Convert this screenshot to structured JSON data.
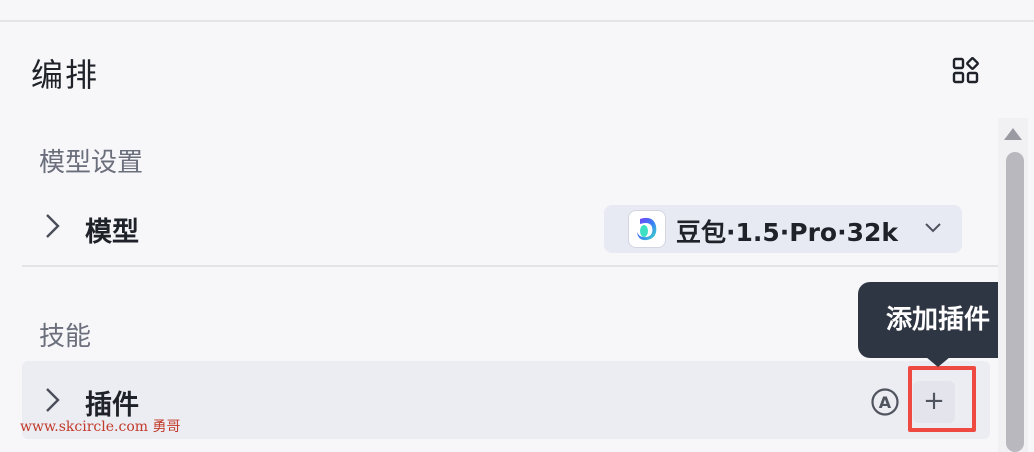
{
  "header": {
    "title": "编排"
  },
  "sections": {
    "model_settings": {
      "title": "模型设置",
      "row_label": "模型",
      "selected_model": "豆包·1.5·Pro·32k"
    },
    "skills": {
      "title": "技能",
      "plugin_label": "插件",
      "add_button": "+",
      "tooltip": "添加插件"
    }
  },
  "icons": {
    "layout": "grid-layout-icon",
    "expand": "chevron-right-icon",
    "dropdown": "chevron-down-icon",
    "auto": "auto-a-circle-icon",
    "add": "plus-icon"
  },
  "colors": {
    "highlight": "#ef4a42",
    "tooltip_bg": "#2f3643"
  },
  "watermark": "www.skcircle.com 勇哥"
}
